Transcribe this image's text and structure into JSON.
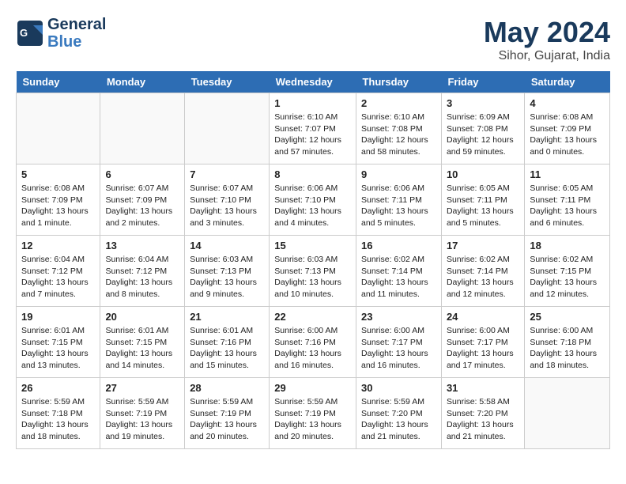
{
  "header": {
    "logo_general": "General",
    "logo_blue": "Blue",
    "month": "May 2024",
    "location": "Sihor, Gujarat, India"
  },
  "weekdays": [
    "Sunday",
    "Monday",
    "Tuesday",
    "Wednesday",
    "Thursday",
    "Friday",
    "Saturday"
  ],
  "weeks": [
    [
      {
        "day": "",
        "info": ""
      },
      {
        "day": "",
        "info": ""
      },
      {
        "day": "",
        "info": ""
      },
      {
        "day": "1",
        "info": "Sunrise: 6:10 AM\nSunset: 7:07 PM\nDaylight: 12 hours and 57 minutes."
      },
      {
        "day": "2",
        "info": "Sunrise: 6:10 AM\nSunset: 7:08 PM\nDaylight: 12 hours and 58 minutes."
      },
      {
        "day": "3",
        "info": "Sunrise: 6:09 AM\nSunset: 7:08 PM\nDaylight: 12 hours and 59 minutes."
      },
      {
        "day": "4",
        "info": "Sunrise: 6:08 AM\nSunset: 7:09 PM\nDaylight: 13 hours and 0 minutes."
      }
    ],
    [
      {
        "day": "5",
        "info": "Sunrise: 6:08 AM\nSunset: 7:09 PM\nDaylight: 13 hours and 1 minute."
      },
      {
        "day": "6",
        "info": "Sunrise: 6:07 AM\nSunset: 7:09 PM\nDaylight: 13 hours and 2 minutes."
      },
      {
        "day": "7",
        "info": "Sunrise: 6:07 AM\nSunset: 7:10 PM\nDaylight: 13 hours and 3 minutes."
      },
      {
        "day": "8",
        "info": "Sunrise: 6:06 AM\nSunset: 7:10 PM\nDaylight: 13 hours and 4 minutes."
      },
      {
        "day": "9",
        "info": "Sunrise: 6:06 AM\nSunset: 7:11 PM\nDaylight: 13 hours and 5 minutes."
      },
      {
        "day": "10",
        "info": "Sunrise: 6:05 AM\nSunset: 7:11 PM\nDaylight: 13 hours and 5 minutes."
      },
      {
        "day": "11",
        "info": "Sunrise: 6:05 AM\nSunset: 7:11 PM\nDaylight: 13 hours and 6 minutes."
      }
    ],
    [
      {
        "day": "12",
        "info": "Sunrise: 6:04 AM\nSunset: 7:12 PM\nDaylight: 13 hours and 7 minutes."
      },
      {
        "day": "13",
        "info": "Sunrise: 6:04 AM\nSunset: 7:12 PM\nDaylight: 13 hours and 8 minutes."
      },
      {
        "day": "14",
        "info": "Sunrise: 6:03 AM\nSunset: 7:13 PM\nDaylight: 13 hours and 9 minutes."
      },
      {
        "day": "15",
        "info": "Sunrise: 6:03 AM\nSunset: 7:13 PM\nDaylight: 13 hours and 10 minutes."
      },
      {
        "day": "16",
        "info": "Sunrise: 6:02 AM\nSunset: 7:14 PM\nDaylight: 13 hours and 11 minutes."
      },
      {
        "day": "17",
        "info": "Sunrise: 6:02 AM\nSunset: 7:14 PM\nDaylight: 13 hours and 12 minutes."
      },
      {
        "day": "18",
        "info": "Sunrise: 6:02 AM\nSunset: 7:15 PM\nDaylight: 13 hours and 12 minutes."
      }
    ],
    [
      {
        "day": "19",
        "info": "Sunrise: 6:01 AM\nSunset: 7:15 PM\nDaylight: 13 hours and 13 minutes."
      },
      {
        "day": "20",
        "info": "Sunrise: 6:01 AM\nSunset: 7:15 PM\nDaylight: 13 hours and 14 minutes."
      },
      {
        "day": "21",
        "info": "Sunrise: 6:01 AM\nSunset: 7:16 PM\nDaylight: 13 hours and 15 minutes."
      },
      {
        "day": "22",
        "info": "Sunrise: 6:00 AM\nSunset: 7:16 PM\nDaylight: 13 hours and 16 minutes."
      },
      {
        "day": "23",
        "info": "Sunrise: 6:00 AM\nSunset: 7:17 PM\nDaylight: 13 hours and 16 minutes."
      },
      {
        "day": "24",
        "info": "Sunrise: 6:00 AM\nSunset: 7:17 PM\nDaylight: 13 hours and 17 minutes."
      },
      {
        "day": "25",
        "info": "Sunrise: 6:00 AM\nSunset: 7:18 PM\nDaylight: 13 hours and 18 minutes."
      }
    ],
    [
      {
        "day": "26",
        "info": "Sunrise: 5:59 AM\nSunset: 7:18 PM\nDaylight: 13 hours and 18 minutes."
      },
      {
        "day": "27",
        "info": "Sunrise: 5:59 AM\nSunset: 7:19 PM\nDaylight: 13 hours and 19 minutes."
      },
      {
        "day": "28",
        "info": "Sunrise: 5:59 AM\nSunset: 7:19 PM\nDaylight: 13 hours and 20 minutes."
      },
      {
        "day": "29",
        "info": "Sunrise: 5:59 AM\nSunset: 7:19 PM\nDaylight: 13 hours and 20 minutes."
      },
      {
        "day": "30",
        "info": "Sunrise: 5:59 AM\nSunset: 7:20 PM\nDaylight: 13 hours and 21 minutes."
      },
      {
        "day": "31",
        "info": "Sunrise: 5:58 AM\nSunset: 7:20 PM\nDaylight: 13 hours and 21 minutes."
      },
      {
        "day": "",
        "info": ""
      }
    ]
  ]
}
